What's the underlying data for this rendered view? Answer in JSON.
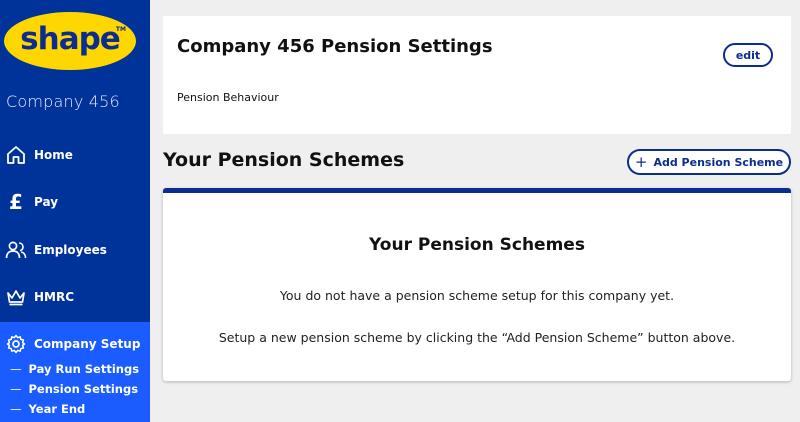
{
  "brand": {
    "logo_text": "shape",
    "logo_tm": "TM",
    "company_name": "Company 456"
  },
  "sidebar": {
    "items": [
      {
        "label": "Home",
        "icon": "home-icon"
      },
      {
        "label": "Pay",
        "icon": "pound-icon"
      },
      {
        "label": "Employees",
        "icon": "people-icon"
      },
      {
        "label": "HMRC",
        "icon": "crown-icon"
      },
      {
        "label": "Company Setup",
        "icon": "gear-icon"
      }
    ],
    "sub_items": [
      {
        "label": "Pay Run Settings"
      },
      {
        "label": "Pension Settings"
      },
      {
        "label": "Year End"
      }
    ],
    "sub_dash": "—",
    "pound_glyph": "£"
  },
  "settings": {
    "title": "Company 456 Pension Settings",
    "edit_label": "edit",
    "behaviour_label": "Pension Behaviour"
  },
  "schemes": {
    "heading": "Your Pension Schemes",
    "add_label": "Add Pension Scheme",
    "add_plus": "+",
    "card_heading": "Your Pension Schemes",
    "empty_message": "You do not have a pension scheme setup for this company yet.",
    "help_message": "Setup a new pension scheme by clicking the “Add Pension Scheme” button above."
  },
  "colors": {
    "sidebar": "#003399",
    "active": "#1a5cff",
    "logo_yellow": "#ffd700",
    "accent": "#0b2d8f",
    "background": "#efefef"
  }
}
